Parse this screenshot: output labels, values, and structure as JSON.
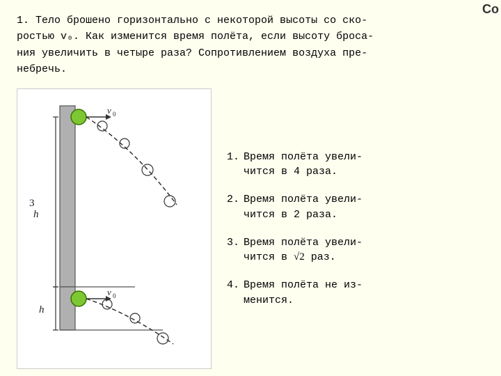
{
  "corner": {
    "text": "Co"
  },
  "question": {
    "text": "1.  Тело брошено горизонтально с некоторой высоты со ско-\nростью v₀. Как изменится время полёта, если высоту броса-\nния увеличить в четыре раза? Сопротивлением воздуха пре-\nнебречь."
  },
  "answers": [
    {
      "number": "1.",
      "text": "Время полёта увели-\nчится в 4 раза."
    },
    {
      "number": "2.",
      "text": "Время полёта увели-\nчится в 2 раза."
    },
    {
      "number": "3.",
      "text": "Время полёта увели-\nчится в √2 раз."
    },
    {
      "number": "4.",
      "text": "Время полёта не из-\nменится."
    }
  ],
  "labels": {
    "v0": "v₀",
    "3h": "3h",
    "h": "h"
  }
}
